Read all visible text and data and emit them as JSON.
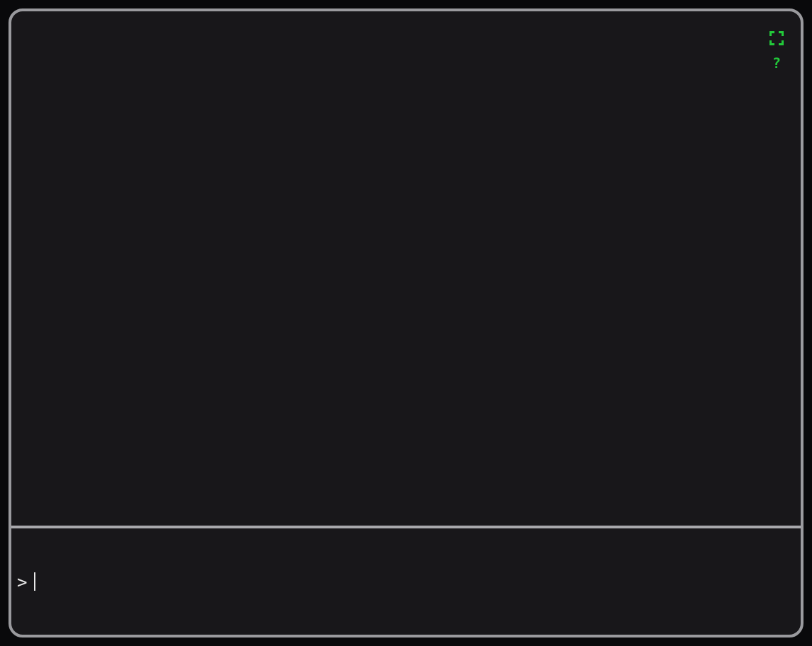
{
  "terminal": {
    "tools": [
      {
        "kind": "fullscreen"
      },
      {
        "kind": "help",
        "label": "?"
      }
    ],
    "prompt": ">"
  }
}
